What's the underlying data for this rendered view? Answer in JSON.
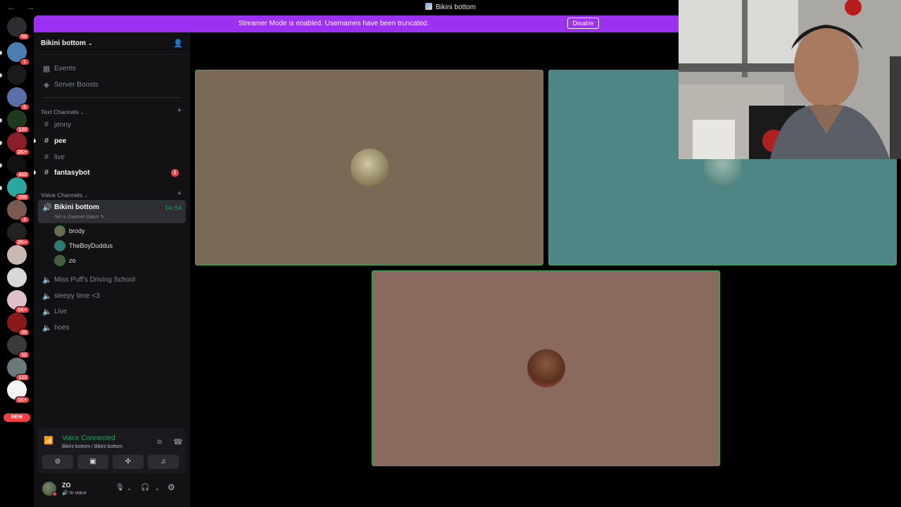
{
  "window": {
    "title": "Bikini bottom",
    "nav": "← →"
  },
  "banner": {
    "message": "Streamer Mode is enabled. Usernames have been truncated.",
    "disable_label": "Disable",
    "color": "#9b32f2"
  },
  "guilds": [
    {
      "badge": "59",
      "color": "#2b2d31"
    },
    {
      "badge": "1",
      "color": "#4a7fb0"
    },
    {
      "badge": "",
      "color": "#1a1a1a"
    },
    {
      "badge": "6",
      "color": "#5a6fa8"
    },
    {
      "badge": "120",
      "color": "#1e3a1e"
    },
    {
      "badge": "2K+",
      "color": "#8a1f2a"
    },
    {
      "badge": "433",
      "color": "#111111"
    },
    {
      "badge": "206",
      "color": "#2aa7a0"
    },
    {
      "badge": "4",
      "color": "#7a5a50"
    },
    {
      "badge": "2K+",
      "color": "#222222"
    },
    {
      "badge": "",
      "color": "#c9b9b0"
    },
    {
      "badge": "",
      "color": "#d8d8d8"
    },
    {
      "badge": "1K+",
      "color": "#e0c0c8"
    },
    {
      "badge": "39",
      "color": "#8a1a1a"
    },
    {
      "badge": "12",
      "color": "#3a3a3a"
    },
    {
      "badge": "123",
      "color": "#6a7a7a"
    },
    {
      "badge": "1K+",
      "color": "#f4f4f4"
    }
  ],
  "guilds_new_label": "NEW",
  "server": {
    "name": "Bikini bottom"
  },
  "top_items": [
    {
      "label": "Events",
      "icon": "calendar-icon"
    },
    {
      "label": "Server Boosts",
      "icon": "boost-icon"
    }
  ],
  "text_category": "Text Channels",
  "text_channels": [
    {
      "name": "jenny",
      "unread": false
    },
    {
      "name": "pee",
      "unread": true
    },
    {
      "name": "live",
      "unread": false
    },
    {
      "name": "fantasybot",
      "unread": true,
      "mentions": "1"
    }
  ],
  "voice_category": "Voice Channels",
  "active_voice": {
    "name": "Bikini bottom",
    "time": "14:54",
    "status": "Set a channel status"
  },
  "voice_users": [
    {
      "name": "brody",
      "color": "#6b6b4f"
    },
    {
      "name": "TheBoyDuddus",
      "color": "#2f7a78"
    },
    {
      "name": "zo",
      "color": "#4a5a3a"
    }
  ],
  "other_voice": [
    "Miss Puff's Driving School",
    "sleepy time <3",
    "Live",
    "hoes"
  ],
  "voice_panel": {
    "title": "Voice Connected",
    "location": "Bikini bottom / Bikini bottom"
  },
  "user": {
    "name": "ZO",
    "status": "In voice"
  },
  "tiles": [
    {
      "bg": "#7a6a55",
      "avatar": "#b9b08a"
    },
    {
      "bg": "#4e8585",
      "avatar": "#7aa49c"
    },
    {
      "bg": "#8a6a5e",
      "avatar": "#6a4030"
    }
  ],
  "accent": {
    "green": "#23a55a",
    "red": "#f23f43",
    "tile_border": "#3ba55c"
  }
}
